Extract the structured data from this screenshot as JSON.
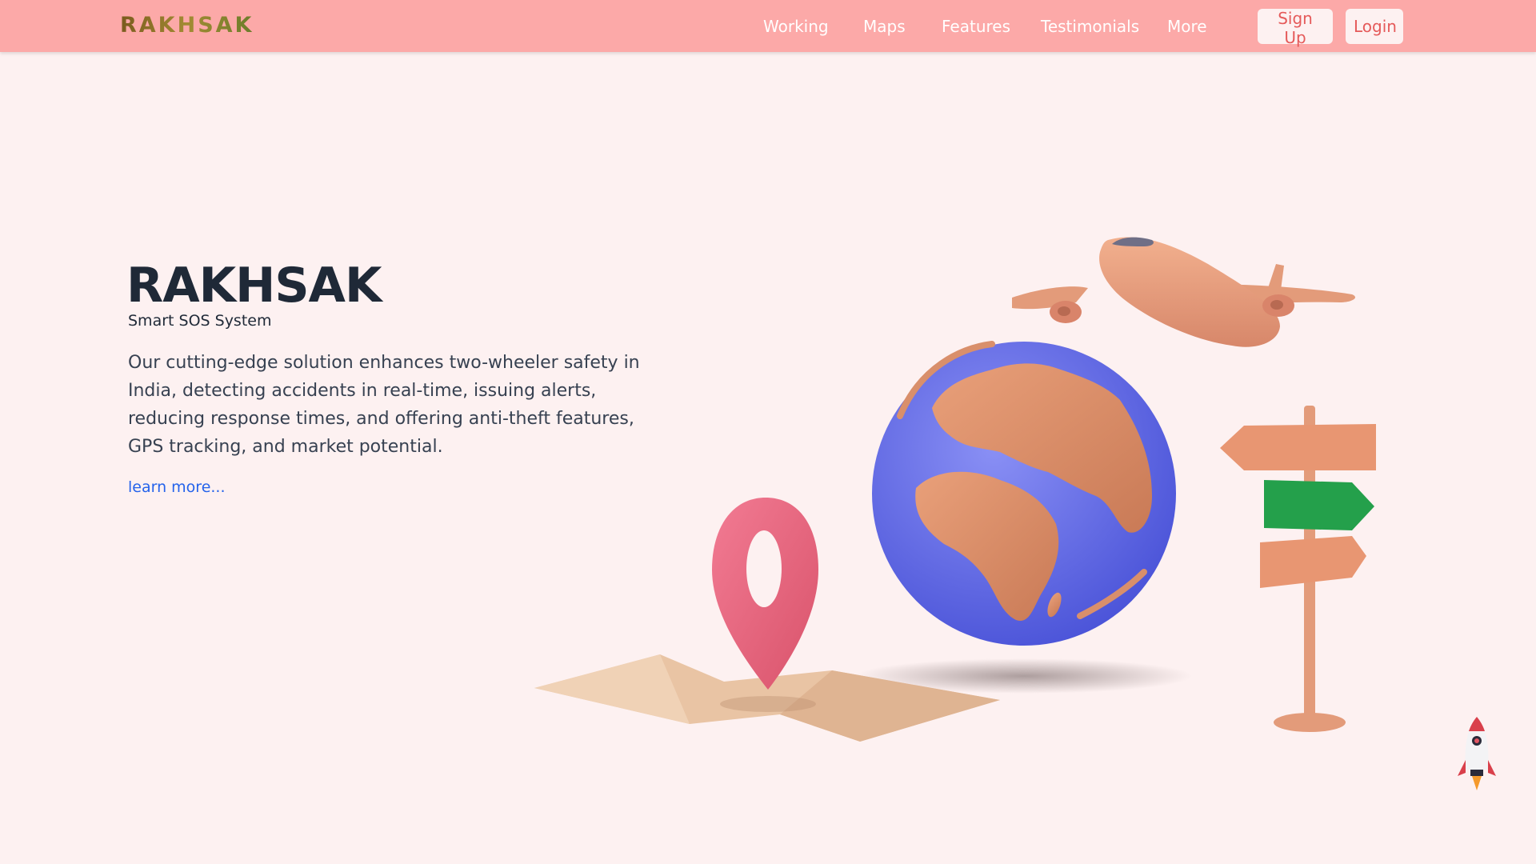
{
  "header": {
    "logo": "RAKHSAK",
    "nav": [
      "Working",
      "Maps",
      "Features",
      "Testimonials",
      "More"
    ],
    "signup_label": "Sign Up",
    "login_label": "Login"
  },
  "hero": {
    "title": "RAKHSAK",
    "subtitle": "Smart SOS System",
    "description": "Our cutting-edge solution enhances two-wheeler safety in India, detecting accidents in real-time, issuing alerts, reducing response times, and offering anti-theft features, GPS tracking, and market potential.",
    "link_label": "learn more..."
  },
  "colors": {
    "navbar": "#fca9a8",
    "background": "#fdf1f1",
    "heading": "#1f2937",
    "link": "#2563eb",
    "button_text": "#e55a5a"
  },
  "icons": [
    "map-pin-icon",
    "globe-icon",
    "airplane-icon",
    "signpost-icon",
    "folded-map-icon",
    "rocket-icon"
  ]
}
